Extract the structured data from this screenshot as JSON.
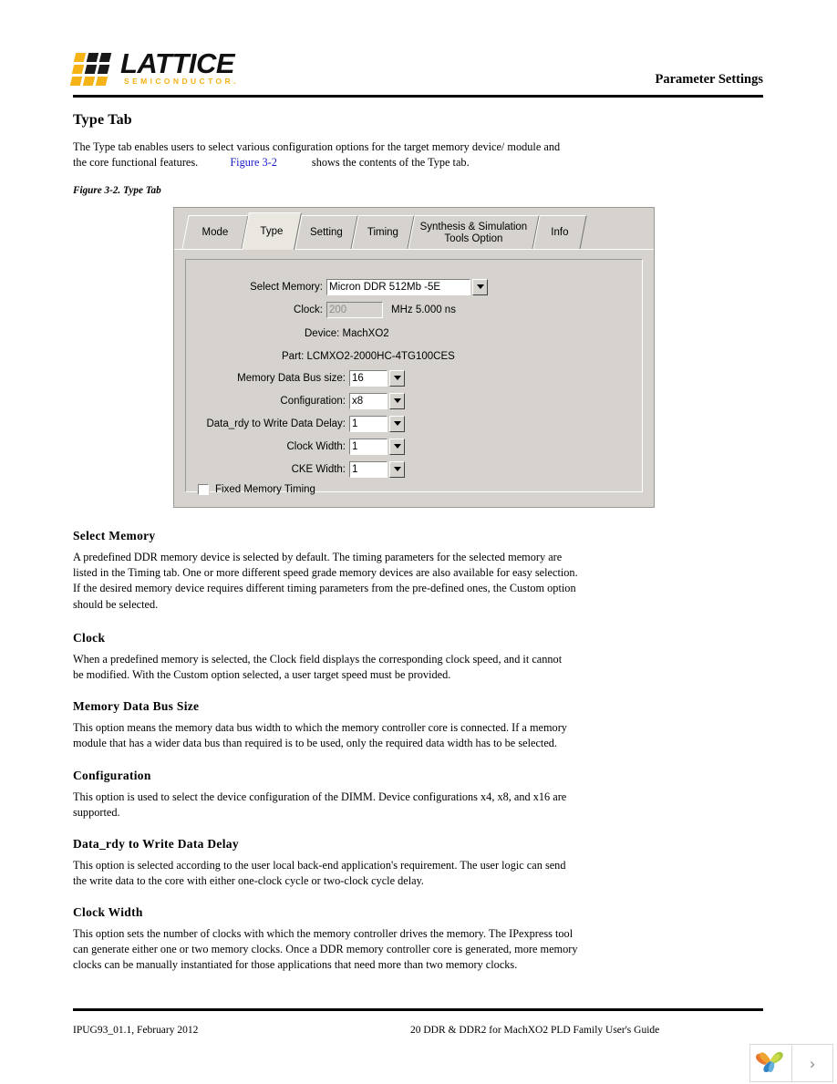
{
  "header": {
    "brand_name": "LATTICE",
    "brand_tagline": "SEMICONDUCTOR.",
    "section_title": "Parameter Settings"
  },
  "content": {
    "heading": "Type Tab",
    "intro_part1": "The Type tab enables users to select various configuration options for the target memory device/ module and the core functional features.",
    "intro_link": "Figure 3-2",
    "intro_part2": "shows the contents of the Type tab.",
    "figure_caption": "Figure 3-2. Type Tab",
    "sections": [
      {
        "heading": "Select Memory",
        "body": "A predefined DDR memory device is selected by default. The timing parameters for the selected memory are listed in the Timing tab. One or more different speed grade memory devices are also available for easy selection. If the desired memory device requires different timing parameters from the pre-defined ones, the Custom option should be selected."
      },
      {
        "heading": "Clock",
        "body": "When a predefined memory is selected, the Clock field displays the corresponding clock speed, and it cannot be modified. With the Custom option selected, a user target speed must be provided."
      },
      {
        "heading": "Memory Data Bus Size",
        "body": "This option means the memory data bus width to which the memory controller core is connected. If a memory module that has a wider data bus than required is to be used, only the required data width has to be selected."
      },
      {
        "heading": "Configuration",
        "body": "This option is used to select the device configuration of the DIMM. Device configurations x4, x8, and x16 are supported."
      },
      {
        "heading": "Data_rdy to Write Data Delay",
        "body": "This option is selected according to the user local back-end application's requirement. The user logic can send the write data to the core with either one-clock cycle or two-clock cycle delay."
      },
      {
        "heading": "Clock Width",
        "body": "This option sets the number of clocks with which the memory controller drives the memory. The IPexpress tool can generate either one or two memory clocks. Once a DDR memory controller core is generated, more memory clocks can be manually instantiated for those applications that need more than two memory clocks."
      }
    ]
  },
  "dialog": {
    "tabs": [
      {
        "label": "Mode",
        "active": false
      },
      {
        "label": "Type",
        "active": true
      },
      {
        "label": "Setting",
        "active": false
      },
      {
        "label": "Timing",
        "active": false
      },
      {
        "label": "Synthesis & Simulation\nTools Option",
        "active": false
      },
      {
        "label": "Info",
        "active": false
      }
    ],
    "fields": {
      "select_memory_label": "Select Memory:",
      "select_memory_value": "Micron DDR 512Mb -5E",
      "clock_label": "Clock:",
      "clock_value": "200",
      "clock_unit": "MHz 5.000 ns",
      "device_text": "Device: MachXO2",
      "part_text": "Part: LCMXO2-2000HC-4TG100CES",
      "bus_size_label": "Memory Data Bus size:",
      "bus_size_value": "16",
      "configuration_label": "Configuration:",
      "configuration_value": "x8",
      "data_rdy_label": "Data_rdy to Write Data Delay:",
      "data_rdy_value": "1",
      "clock_width_label": "Clock Width:",
      "clock_width_value": "1",
      "cke_width_label": "CKE Width:",
      "cke_width_value": "1",
      "fixed_timing_label": "Fixed Memory Timing"
    }
  },
  "footer": {
    "left": "IPUG93_01.1, February 2012",
    "right": "20 DDR & DDR2 for MachXO2 PLD Family User's Guide"
  },
  "widget": {
    "next_glyph": "›"
  },
  "colors": {
    "brand_yellow": "#f5b316",
    "link_blue": "#1a1ad0",
    "dialog_face": "#d6d3ce",
    "tab_active": "#e9e7e0"
  }
}
